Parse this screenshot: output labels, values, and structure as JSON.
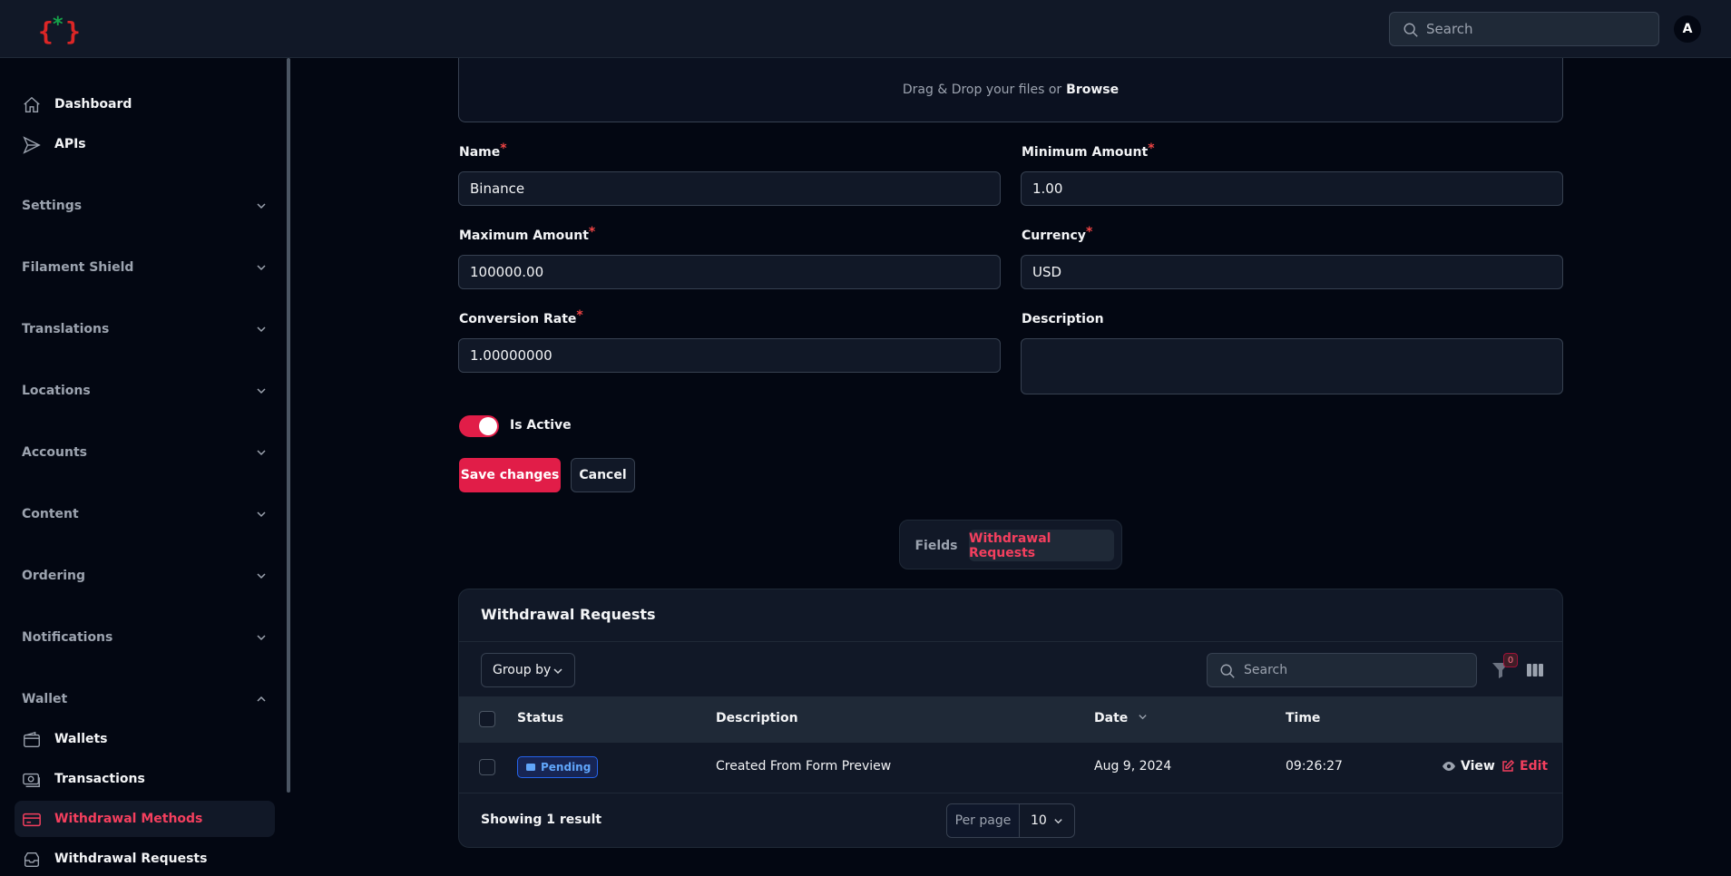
{
  "header": {
    "search_placeholder": "Search",
    "avatar_initial": "A"
  },
  "sidebar": {
    "top_items": [
      {
        "label": "Dashboard",
        "icon": "home-icon"
      },
      {
        "label": "APIs",
        "icon": "send-icon"
      }
    ],
    "groups": [
      "Settings",
      "Filament Shield",
      "Translations",
      "Locations",
      "Accounts",
      "Content",
      "Ordering",
      "Notifications",
      "Wallet"
    ],
    "wallet_items": [
      {
        "label": "Wallets",
        "icon": "wallet-icon"
      },
      {
        "label": "Transactions",
        "icon": "cash-icon"
      },
      {
        "label": "Withdrawal Methods",
        "icon": "credit-card-icon",
        "active": true
      },
      {
        "label": "Withdrawal Requests",
        "icon": "inbox-stack-icon"
      }
    ]
  },
  "form": {
    "dropzone_text": "Drag & Drop your files or",
    "dropzone_link": "Browse",
    "name_label": "Name",
    "name_value": "Binance",
    "min_label": "Minimum Amount",
    "min_value": "1.00",
    "max_label": "Maximum Amount",
    "max_value": "100000.00",
    "currency_label": "Currency",
    "currency_value": "USD",
    "rate_label": "Conversion Rate",
    "rate_value": "1.00000000",
    "description_label": "Description",
    "description_value": "",
    "required_mark": "*",
    "is_active_label": "Is Active",
    "is_active": true,
    "save_label": "Save changes",
    "cancel_label": "Cancel"
  },
  "tabs": {
    "fields": "Fields",
    "withdrawal_requests": "Withdrawal Requests",
    "active": "withdrawal_requests"
  },
  "table": {
    "title": "Withdrawal Requests",
    "group_by": "Group by",
    "search_placeholder": "Search",
    "filter_count": "0",
    "columns": {
      "status": "Status",
      "description": "Description",
      "date": "Date",
      "time": "Time"
    },
    "rows": [
      {
        "status": "Pending",
        "description": "Created From Form Preview",
        "date": "Aug 9, 2024",
        "time": "09:26:27"
      }
    ],
    "view_label": "View",
    "edit_label": "Edit",
    "showing": "Showing 1 result",
    "per_page_label": "Per page",
    "per_page_value": "10"
  },
  "colors": {
    "accent": "#e11d48",
    "background": "#030712",
    "panel": "#111827",
    "pending": "#60a5fa"
  }
}
